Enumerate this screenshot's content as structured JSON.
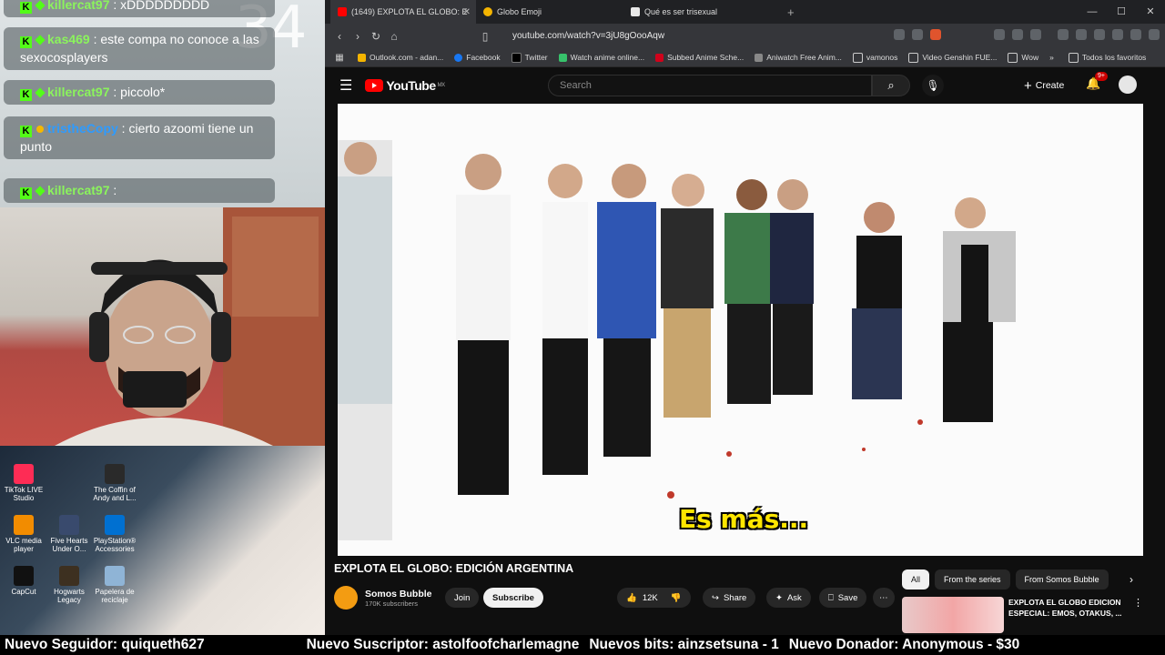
{
  "stream": {
    "timer": "34",
    "chat": [
      {
        "user": "killercat97",
        "text": "xDDDDDDDDD",
        "color": "green"
      },
      {
        "user": "kas469",
        "text": "este compa no conoce a las sexocosplayers",
        "color": "green"
      },
      {
        "user": "killercat97",
        "text": "piccolo*",
        "color": "green"
      },
      {
        "user": "tristheCopy",
        "text": "cierto azoomi tiene un punto",
        "color": "blue"
      },
      {
        "user": "killercat97",
        "text": "",
        "color": "green"
      }
    ],
    "desktop_icons": [
      {
        "label": "TikTok LIVE Studio"
      },
      {
        "label": "The Coffin of Andy and L..."
      },
      {
        "label": "VLC media player"
      },
      {
        "label": "Five Hearts Under O..."
      },
      {
        "label": "PlayStation® Accessories"
      },
      {
        "label": "CapCut"
      },
      {
        "label": "Hogwarts Legacy"
      },
      {
        "label": "Papelera de reciclaje"
      }
    ]
  },
  "browser": {
    "tabs": [
      {
        "label": "(1649) EXPLOTA EL GLOBO: E",
        "active": true
      },
      {
        "label": "Globo Emoji",
        "active": false
      },
      {
        "label": "Qué es ser trisexual",
        "active": false
      }
    ],
    "url": "youtube.com/watch?v=3jU8gOooAqw",
    "bookmarks": [
      "Outlook.com - adan...",
      "Facebook",
      "Twitter",
      "Watch anime online...",
      "Subbed Anime Sche...",
      "Aniwatch Free Anim...",
      "vamonos",
      "Video Genshin FUE...",
      "Wow",
      "Todos los favoritos"
    ]
  },
  "youtube": {
    "logo": "YouTube",
    "region": "MX",
    "search_placeholder": "Search",
    "create_label": "Create",
    "notif_badge": "9+",
    "subtitle": "Es más...",
    "video_title": "EXPLOTA EL GLOBO: EDICIÓN ARGENTINA",
    "channel_name": "Somos Bubble",
    "channel_subs": "170K subscribers",
    "join_label": "Join",
    "subscribe_label": "Subscribe",
    "likes": "12K",
    "share_label": "Share",
    "ask_label": "Ask",
    "save_label": "Save",
    "chips": [
      "All",
      "From the series",
      "From Somos Bubble"
    ],
    "rec_title": "EXPLOTA EL GLOBO EDICION ESPECIAL: EMOS, OTAKUS, ..."
  },
  "ticker": [
    "Nuevo Seguidor: quiqueth627",
    "Nuevo Suscriptor: astolfoofcharlemagne",
    "Nuevos bits: ainzsetsuna - 1",
    "Nuevo Donador: Anonymous - $30"
  ],
  "colors": {
    "kick_green": "#53fc18",
    "yt_red": "#ff0000",
    "subtitle_yellow": "#ffe600"
  }
}
